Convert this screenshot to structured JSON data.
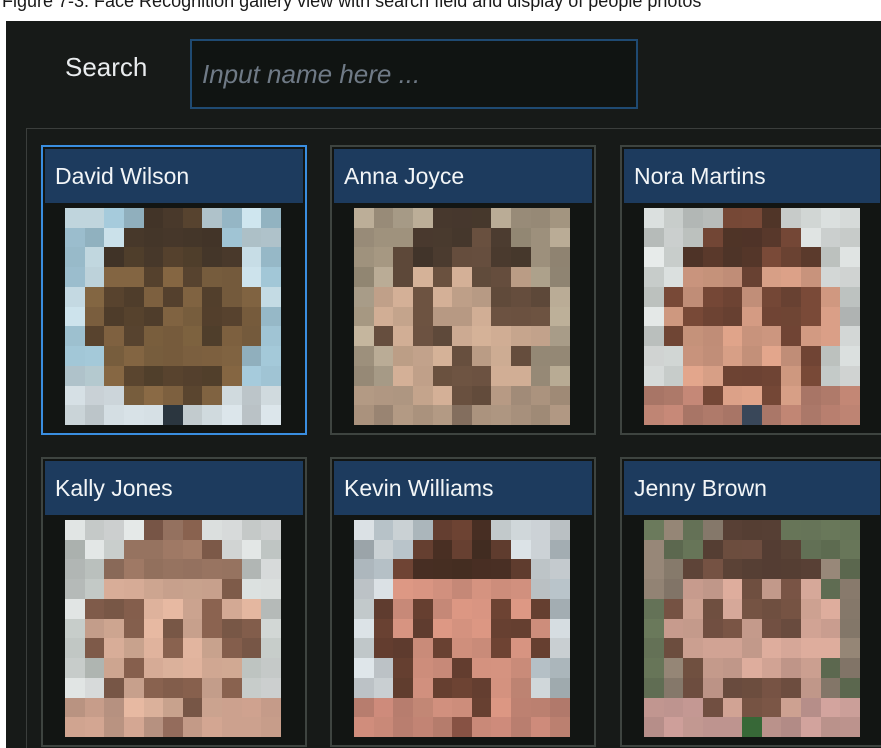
{
  "caption": "Figure 7-3. Face Recognition gallery view with search field and display of people photos",
  "search": {
    "label": "Search",
    "placeholder": "Input name here ..."
  },
  "gallery": {
    "people": [
      {
        "name": "David Wilson",
        "selected": true
      },
      {
        "name": "Anna Joyce",
        "selected": false
      },
      {
        "name": "Nora Martins",
        "selected": false
      },
      {
        "name": "Kally Jones",
        "selected": false
      },
      {
        "name": "Kevin Williams",
        "selected": false
      },
      {
        "name": "Jenny Brown",
        "selected": false
      }
    ]
  },
  "colors": {
    "panel_bg": "#171a18",
    "card_title_bg": "#1d3b5e",
    "selection_border": "#3a8ee0",
    "search_border": "#1f4a72"
  }
}
